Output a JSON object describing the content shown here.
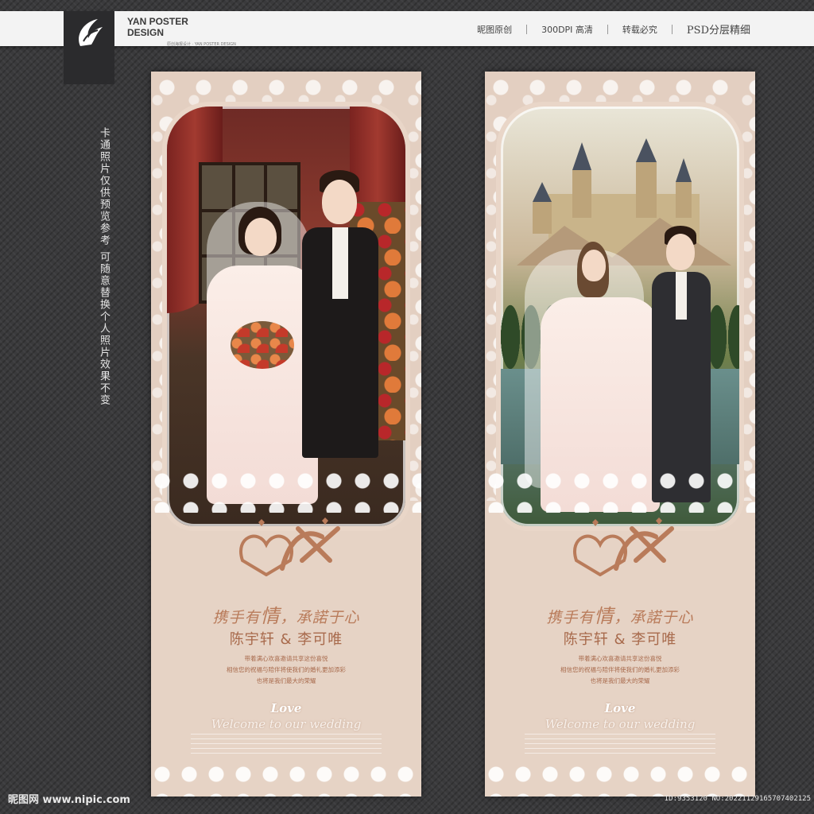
{
  "header": {
    "brand_line1": "YAN POSTER",
    "brand_line2": "DESIGN",
    "brand_sub": "原创海报设计 · YAN POSTER DESIGN",
    "menu": [
      "昵图原创",
      "300DPI 高清",
      "转载必究",
      "PSD分层精细"
    ]
  },
  "side_note": "卡通照片仅供预览参考 可随意替换个人照片效果不变",
  "posters": [
    {
      "slogan_pre": "携手有",
      "slogan_big": "情",
      "slogan_post": "，承諾于心",
      "names": "陈宇轩 & 李可唯",
      "invite_lines": [
        "带着满心欢喜邀请共享这份喜悦",
        "相信您的祝福与陪伴将使我们的婚礼更加添彩",
        "也将是我们最大的荣耀"
      ],
      "love": "Love",
      "welcome": "Welcome to our wedding",
      "scene": "room"
    },
    {
      "slogan_pre": "携手有",
      "slogan_big": "情",
      "slogan_post": "，承諾于心",
      "names": "陈宇轩 & 李可唯",
      "invite_lines": [
        "带着满心欢喜邀请共享这份喜悦",
        "相信您的祝福与陪伴将使我们的婚礼更加添彩",
        "也将是我们最大的荣耀"
      ],
      "love": "Love",
      "welcome": "Welcome to our wedding",
      "scene": "castle"
    }
  ],
  "footer": {
    "site": "昵图网 www.nipic.com",
    "id": "ID:9353120 NO:20221129165707402125"
  },
  "colors": {
    "background": "#3a3a3c",
    "poster_bg": "#e6d3c5",
    "accent": "#b97b5a"
  },
  "icons": {
    "logo": "wing-logo-icon",
    "emblem": "hearts-emblem-icon"
  }
}
